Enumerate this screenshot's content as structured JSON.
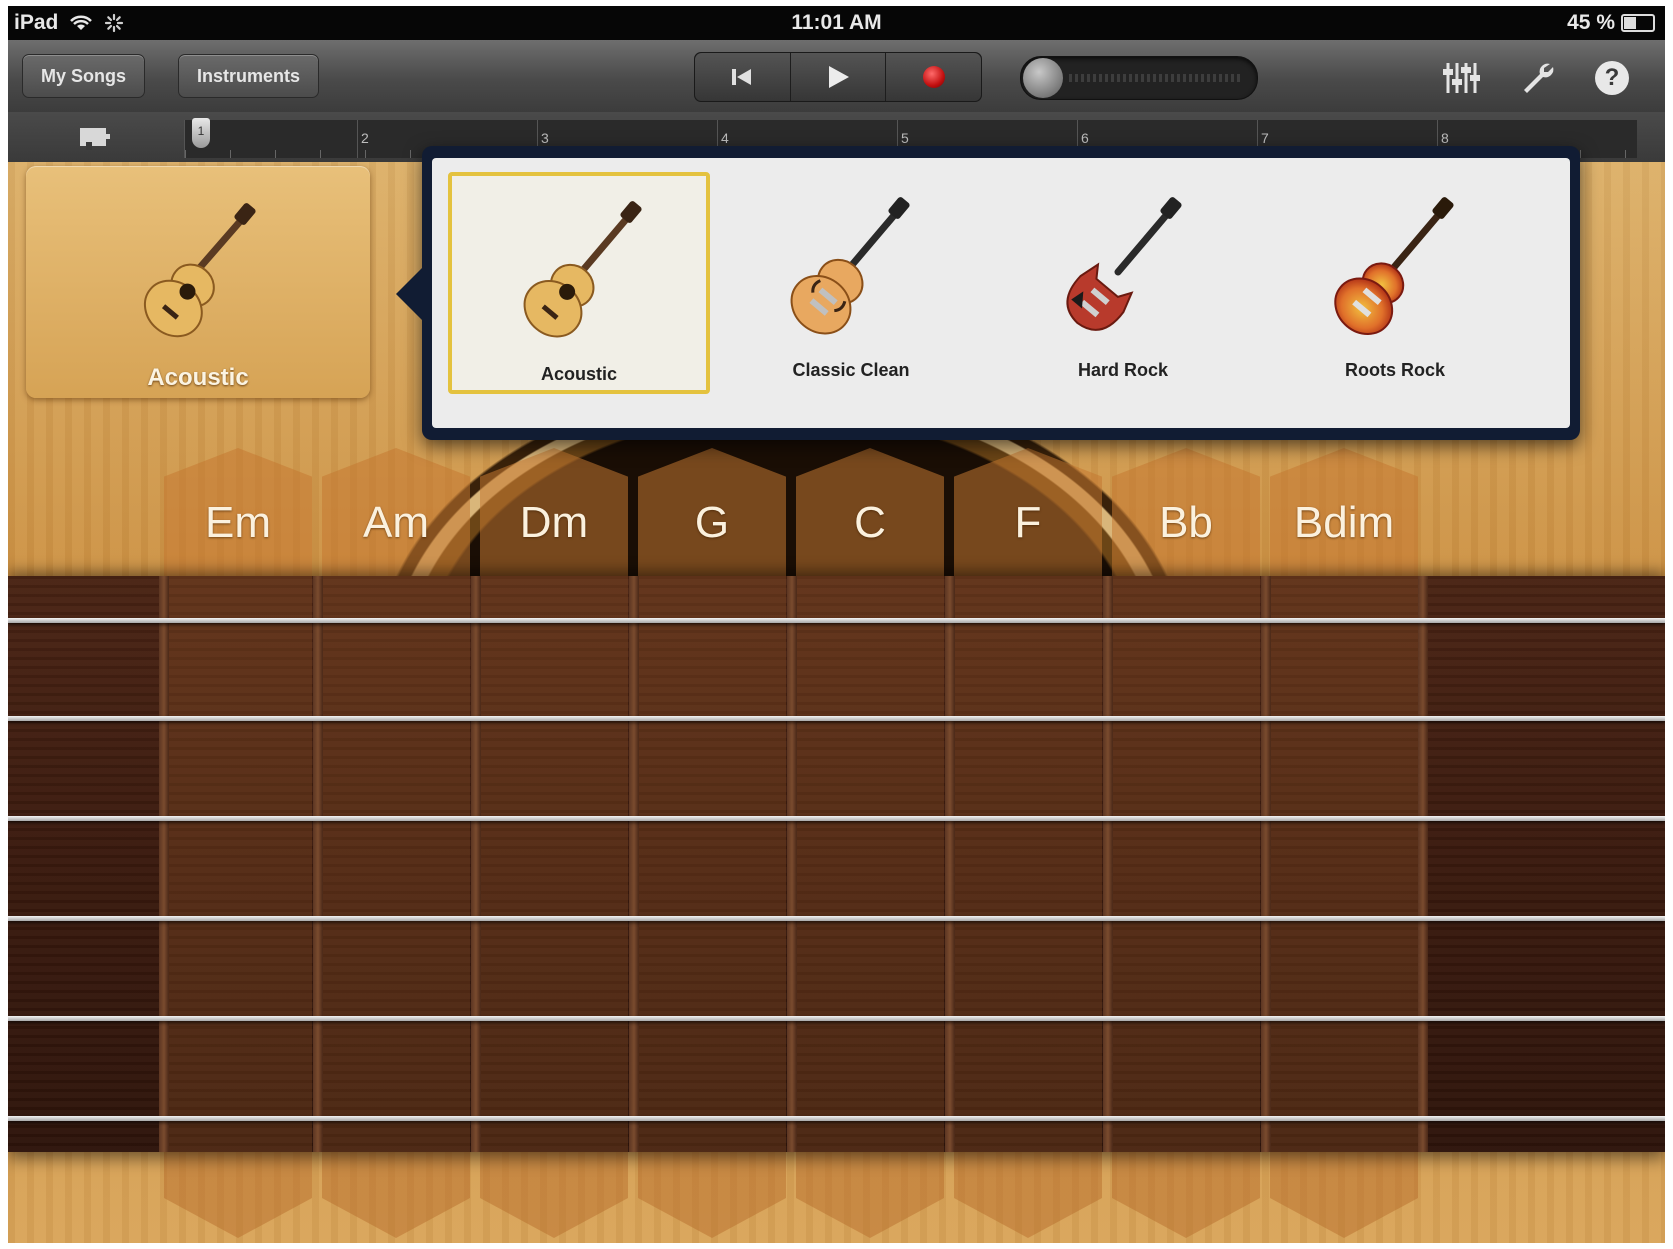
{
  "status_bar": {
    "device": "iPad",
    "time": "11:01 AM",
    "battery": "45 %"
  },
  "toolbar": {
    "my_songs_label": "My Songs",
    "instruments_label": "Instruments",
    "icons": [
      "go-to-beginning-icon",
      "play-icon",
      "record-icon",
      "mixer-icon",
      "wrench-icon",
      "help-icon"
    ]
  },
  "ruler": {
    "bars": [
      "2",
      "3",
      "4",
      "5",
      "6",
      "7",
      "8"
    ],
    "playhead": "1"
  },
  "current_instrument": {
    "label": "Acoustic"
  },
  "instrument_picker": {
    "options": [
      {
        "label": "Acoustic",
        "selected": true
      },
      {
        "label": "Classic Clean",
        "selected": false
      },
      {
        "label": "Hard Rock",
        "selected": false
      },
      {
        "label": "Roots Rock",
        "selected": false
      }
    ]
  },
  "chords": [
    "Em",
    "Am",
    "Dm",
    "G",
    "C",
    "F",
    "Bb",
    "Bdim"
  ],
  "colors": {
    "wood": "#c89548",
    "fretboard": "#3a1a0e",
    "selection": "#e4c23e",
    "record": "#c21010"
  }
}
